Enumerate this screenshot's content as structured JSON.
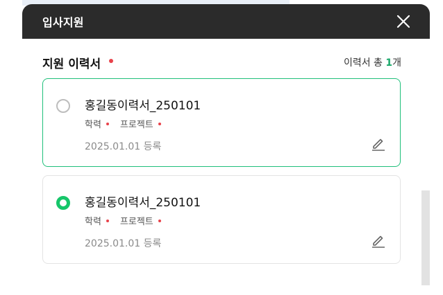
{
  "modal": {
    "title": "입사지원",
    "close_icon": "close-icon"
  },
  "section": {
    "title": "지원 이력서",
    "count_prefix": "이력서 총 ",
    "count_num": "1",
    "count_suffix": "개"
  },
  "resumes": [
    {
      "name": "홍길동이력서_250101",
      "tags": [
        "학력",
        "프로젝트"
      ],
      "date": "2025.01.01 등록",
      "selected": false,
      "focused": true
    },
    {
      "name": "홍길동이력서_250101",
      "tags": [
        "학력",
        "프로젝트"
      ],
      "date": "2025.01.01 등록",
      "selected": true,
      "focused": false
    }
  ],
  "colors": {
    "header_bg": "#2b2b2b",
    "accent_green": "#16c66a",
    "required_red": "#e8424a"
  }
}
